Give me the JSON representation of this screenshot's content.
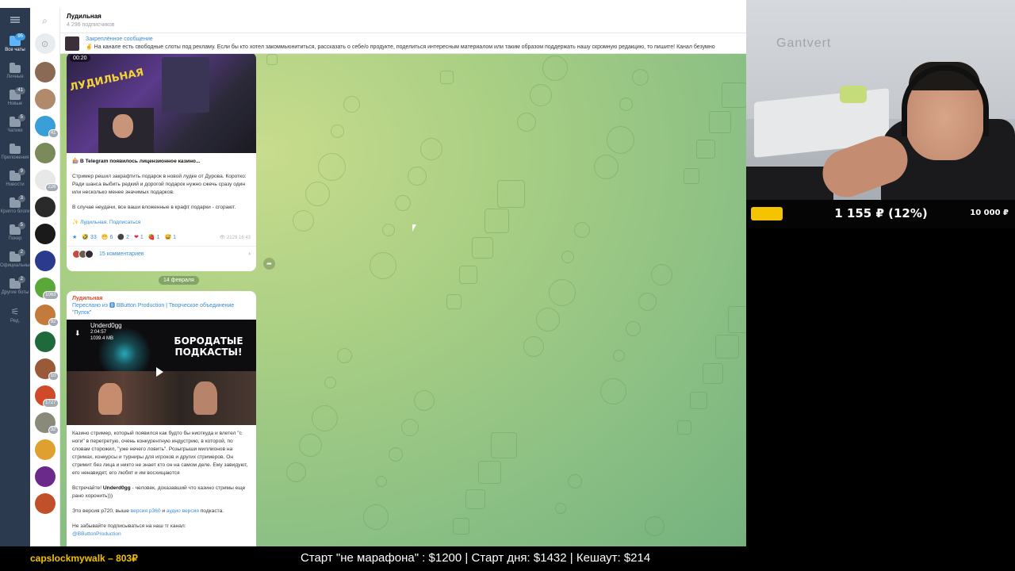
{
  "sidebar": {
    "folders": [
      {
        "label": "Все чаты",
        "badge": "95",
        "active": true
      },
      {
        "label": "Личные",
        "badge": ""
      },
      {
        "label": "Новые",
        "badge": "41"
      },
      {
        "label": "Чатики",
        "badge": "5"
      },
      {
        "label": "Приложения",
        "badge": ""
      },
      {
        "label": "Новости",
        "badge": "9"
      },
      {
        "label": "Крипто блоги",
        "badge": "3"
      },
      {
        "label": "Покер",
        "badge": "5"
      },
      {
        "label": "Официальные",
        "badge": "2"
      },
      {
        "label": "Другие боты",
        "badge": "2"
      },
      {
        "label": "Ред.",
        "badge": ""
      }
    ]
  },
  "chatlist": {
    "badges": [
      "",
      "",
      "41",
      "",
      "226",
      "",
      "",
      "",
      "1063",
      "92",
      "",
      "10",
      "1727",
      "32",
      "",
      "",
      "",
      ""
    ]
  },
  "channel": {
    "title": "Лудильная",
    "subscribers": "4 296 подписчиков"
  },
  "pinned": {
    "title": "Закреплённое сообщение",
    "text": "✌ На канале есть свободные слоты под рекламу.  Если бы кто хотел закоммьюнититься, рассказать о себе/о продукте, поделиться интересным материалом или таким образом поддержать нашу скромную редакцию, то пишите! Канал безумно"
  },
  "post1": {
    "duration": "00:20",
    "logo_text": "ЛУДИЛЬНАЯ",
    "headline": "🎰 В Telegram появилось лицензионное казино...",
    "p1": "Стример решил закрафтить подарок в новой лудке от Дурова. Коротко: Ради шанса выбить редкий и дорогой подарок нужно сжечь сразу один или несколько менее значимых подарков.",
    "p2": "В случае неудачи, все ваши вложенные в крафт подарки - сгорают.",
    "signature": "✨ Лудильная. Подписаться",
    "reactions": [
      {
        "emoji": "★",
        "count": ""
      },
      {
        "emoji": "🤣",
        "count": "33"
      },
      {
        "emoji": "😁",
        "count": "6"
      },
      {
        "emoji": "⚫",
        "count": "2"
      },
      {
        "emoji": "❤",
        "count": "1"
      },
      {
        "emoji": "🍓",
        "count": "1"
      },
      {
        "emoji": "😅",
        "count": "1"
      }
    ],
    "views": "👁 2129",
    "time": "16:43",
    "comments": "15 комментариев"
  },
  "date_separator": "14 февраля",
  "post2": {
    "channel": "Лудильная",
    "forwarded": "Переслано из 🅱 BButton Production | Творческое объединение \"Пупок\"",
    "video_name": "Underd0gg",
    "video_stats": "2:04:57\n1039.4 MB",
    "video_headline": "БОРОДАТЫЕ ПОДКАСТЫ!",
    "p1": "Казино стример, который появился как будто бы ниоткуда и влетел \"с ноги\" в перегретую, очень конкурентную индустрию, в которой, по словам сторожил, \"уже нечего ловить\". Розыгрыши миллионов на стримах, конкурсы и турниры для игроков и других стримеров. Он стримит без лица и никто не знает кто он на самом деле. Ему завидуют, его ненавидят, его любят и им восхищаются",
    "p2_lead": "Встречайте! ",
    "p2_name": "Underd0gg",
    "p2_rest": " - человек, доказавший что казино стримы еще рано хоронить)))",
    "p3_a": "Это версия p720, выше ",
    "p3_link1": "версия p360",
    "p3_b": " и ",
    "p3_link2": "аудио версия",
    "p3_c": " подкаста.",
    "p4": "Не забывайте подписываться на наш тг канал:",
    "p5": "@BButtonProduction"
  },
  "cam": {
    "wall_text": "Gantvert"
  },
  "donation_goal": {
    "current": "1 155 ₽ (12%)",
    "target": "10 000 ₽",
    "progress": 0.12,
    "fill_color": "#f5c400"
  },
  "ticker": {
    "nick": "capslockmywalk – 803₽",
    "message": "Старт \"не марафона\" : $1200 | Старт дня: $1432 | Кешаут: $214"
  }
}
